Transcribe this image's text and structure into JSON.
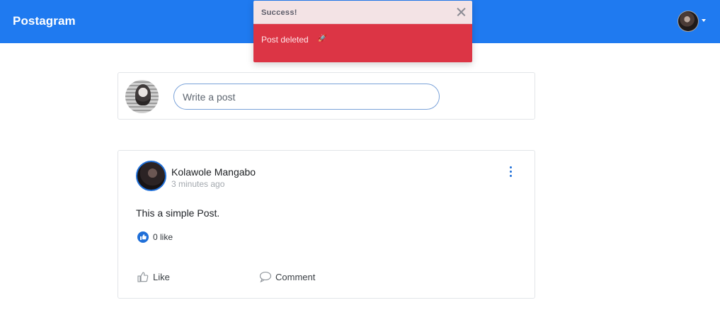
{
  "navbar": {
    "brand": "Postagram",
    "background": "#1f7af0"
  },
  "toast": {
    "title": "Success!",
    "message": "Post deleted",
    "message_emoji": "🚀",
    "header_color": "#f3e3e5",
    "body_color": "#dc3545"
  },
  "create_post": {
    "placeholder": "Write a post"
  },
  "post": {
    "author": "Kolawole Mangabo",
    "time": "3 minutes ago",
    "body": "This a simple Post.",
    "likes": "0 like",
    "actions": {
      "like": "Like",
      "comment": "Comment"
    }
  },
  "icons": {
    "like_badge": "thumbs-up-icon",
    "like_action": "thumbs-up-outline-icon",
    "comment_action": "chat-bubble-icon",
    "menu": "vertical-dots-icon",
    "close": "close-icon"
  }
}
